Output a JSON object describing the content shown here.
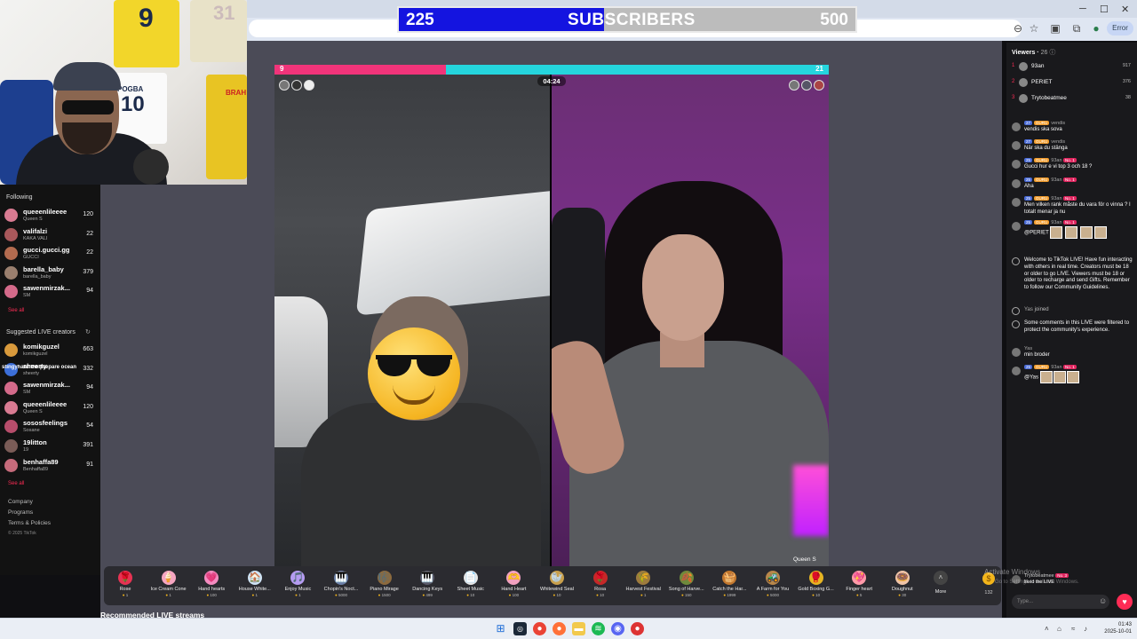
{
  "subscriber_bar": {
    "current": "225",
    "label": "SUBSCRIBERS",
    "goal": "500",
    "progress_fraction": 0.45
  },
  "browser": {
    "profile": "Error"
  },
  "webcam": {
    "jersey_numbers": [
      "9",
      "10",
      "31"
    ],
    "jersey_names": [
      "POGBA",
      "BRAH"
    ]
  },
  "sidebar": {
    "following_title": "Following",
    "following": [
      {
        "name": "queeenlileeee",
        "sub": "Queen S",
        "count": "120",
        "color": "#d97b92"
      },
      {
        "name": "valifalzi",
        "sub": "KAKA VALI",
        "count": "22",
        "color": "#a9585b"
      },
      {
        "name": "gucci.gucci.gg",
        "sub": "GUCCI",
        "count": "22",
        "color": "#b36b4f"
      },
      {
        "name": "barella_baby",
        "sub": "barella_baby",
        "count": "379",
        "color": "#9a7f6e"
      },
      {
        "name": "sawenmirzak...",
        "sub": "SM",
        "count": "94",
        "color": "#d46a8a"
      }
    ],
    "see_all_1": "See all",
    "suggested_title": "Suggested LIVE creators",
    "suggested": [
      {
        "name": "komikguzel",
        "sub": "komikguzel",
        "count": "663",
        "color": "#d99a3c"
      },
      {
        "name": "sheerty",
        "sub": "sheerty",
        "count": "332",
        "color": "#3c6fd9"
      },
      {
        "name": "sawenmirzak...",
        "sub": "SM",
        "count": "94",
        "color": "#d46a8a"
      },
      {
        "name": "queeenlileeee",
        "sub": "Queen S",
        "count": "120",
        "color": "#d97b92"
      },
      {
        "name": "sososfeelings",
        "sub": "Sosane",
        "count": "54",
        "color": "#b74d6b"
      },
      {
        "name": "19litton",
        "sub": "19",
        "count": "391",
        "color": "#7a5c57"
      },
      {
        "name": "benhaffa89",
        "sub": "Benhaffa89",
        "count": "91",
        "color": "#c66b7b"
      }
    ],
    "overlap_text": "stingyhard the prepare ocean",
    "see_all_2": "See all",
    "footer": [
      "Company",
      "Programs",
      "Terms & Policies",
      "© 2025 TikTok"
    ]
  },
  "battle": {
    "left_score": "9",
    "right_score": "21",
    "left_fraction": 0.31,
    "timer": "04:24",
    "host_tag": "Queen S"
  },
  "gifts": [
    {
      "name": "Rose",
      "price": "1",
      "icon": "🌹"
    },
    {
      "name": "Ice Cream Cone",
      "price": "1",
      "icon": "🍦"
    },
    {
      "name": "Hand hearts",
      "price": "100",
      "icon": "💗"
    },
    {
      "name": "House White...",
      "price": "1",
      "icon": "🏠"
    },
    {
      "name": "Enjoy Music",
      "price": "1",
      "icon": "🎵"
    },
    {
      "name": "Chopin's Noct...",
      "price": "5000",
      "icon": "🎹"
    },
    {
      "name": "Piano Mirage",
      "price": "1500",
      "icon": "🎼"
    },
    {
      "name": "Dancing Keys",
      "price": "499",
      "icon": "🎹"
    },
    {
      "name": "Sheet Music",
      "price": "10",
      "icon": "📄"
    },
    {
      "name": "Hand Heart",
      "price": "100",
      "icon": "🫶"
    },
    {
      "name": "Whitewind Seal",
      "price": "10",
      "icon": "🦭"
    },
    {
      "name": "Rosa",
      "price": "10",
      "icon": "🌹"
    },
    {
      "name": "Harvest Festival",
      "price": "1",
      "icon": "🌾"
    },
    {
      "name": "Song of Harve...",
      "price": "150",
      "icon": "🍂"
    },
    {
      "name": "Catch the Har...",
      "price": "1999",
      "icon": "🧺"
    },
    {
      "name": "A Farm for You",
      "price": "5000",
      "icon": "🚜"
    },
    {
      "name": "Gold Boxing G...",
      "price": "10",
      "icon": "🥊"
    },
    {
      "name": "Finger heart",
      "price": "5",
      "icon": "💖"
    },
    {
      "name": "Doughnut",
      "price": "30",
      "icon": "🍩"
    }
  ],
  "gift_more": "More",
  "coins": "132",
  "recommended": "Recommended LIVE streams",
  "panel": {
    "viewers_label": "Viewers",
    "viewers_count": "26",
    "ranking": [
      {
        "rank": "1",
        "name": "93an",
        "score": "917"
      },
      {
        "rank": "2",
        "name": "PERIET",
        "score": "376"
      },
      {
        "rank": "3",
        "name": "Trytobeatmee",
        "score": "38"
      }
    ],
    "messages": [
      {
        "user": "vendis",
        "lvl": "27",
        "text": "vendis ska sova"
      },
      {
        "user": "vendis",
        "lvl": "27",
        "text": "När ska du stänga"
      },
      {
        "user": "93an",
        "lvl": "25",
        "text": "Gucci hur e vi top 3 och 18 ?"
      },
      {
        "user": "93an",
        "lvl": "25",
        "text": "Aha"
      },
      {
        "user": "93an",
        "lvl": "25",
        "text": "Men vilken rank måste du vara för o vinna ? I totalt menar ja nu"
      },
      {
        "user": "93an",
        "lvl": "25",
        "text": "@PERIET"
      }
    ],
    "welcome": "Welcome to TikTok LIVE! Have fun interacting with others in real time. Creators must be 18 or older to go LIVE. Viewers must be 18 or older to recharge and send Gifts. Remember to follow our Community Guidelines.",
    "joined_user": "Yas",
    "joined_text": "joined",
    "filter_notice": "Some comments in this LIVE were filtered to protect the community's experience.",
    "yas_msg": {
      "user": "Yas",
      "text": "min broder"
    },
    "last_msg": {
      "user": "93an",
      "lvl": "25",
      "text": "@Yas"
    },
    "badge_no1": "No. 1",
    "badge_guru": "GURU",
    "liked_user": "Trytobeatmee",
    "liked_badge": "No. 3",
    "liked_text": "liked the LIVE",
    "type_placeholder": "Type..."
  },
  "windows": {
    "activate": "Activate Windows",
    "activate_sub": "Go to Settings to activate Windows.",
    "time": "01:43",
    "date": "2025-10-01"
  }
}
